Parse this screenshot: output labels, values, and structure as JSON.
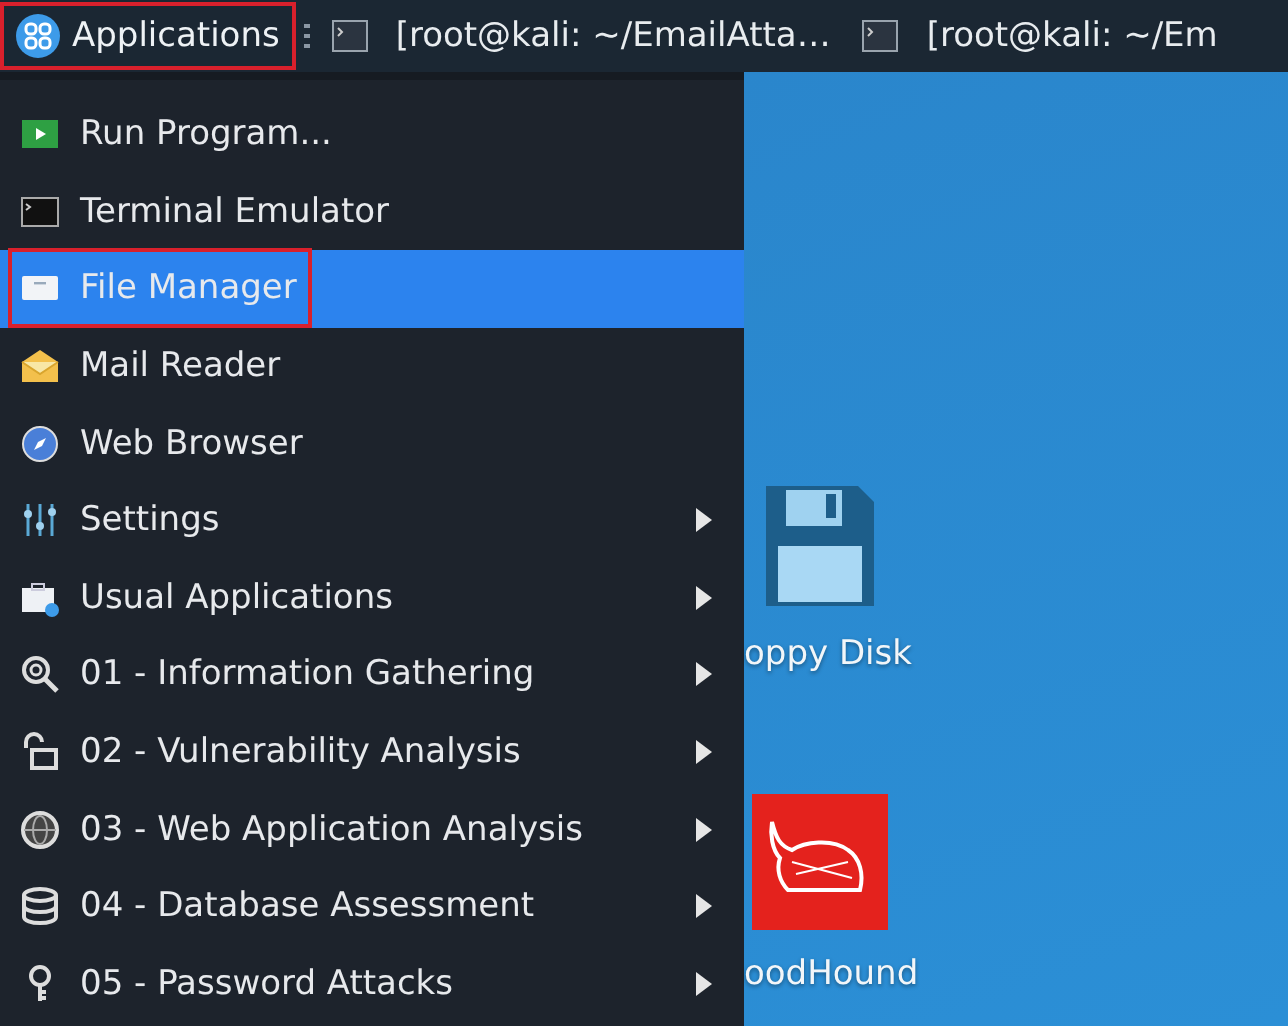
{
  "taskbar": {
    "apps_button": {
      "label": "Applications",
      "highlighted": true
    },
    "tasks": [
      {
        "label": "[root@kali: ~/EmailAtta…"
      },
      {
        "label": "[root@kali: ~/Em"
      }
    ]
  },
  "menu": {
    "items": [
      {
        "label": "Run Program...",
        "submenu": false,
        "selected": false,
        "highlighted": false
      },
      {
        "label": "Terminal Emulator",
        "submenu": false,
        "selected": false,
        "highlighted": false
      },
      {
        "label": "File Manager",
        "submenu": false,
        "selected": true,
        "highlighted": true
      },
      {
        "label": "Mail Reader",
        "submenu": false,
        "selected": false,
        "highlighted": false
      },
      {
        "label": "Web Browser",
        "submenu": false,
        "selected": false,
        "highlighted": false
      },
      {
        "label": "Settings",
        "submenu": true,
        "selected": false,
        "highlighted": false
      },
      {
        "label": "Usual Applications",
        "submenu": true,
        "selected": false,
        "highlighted": false
      },
      {
        "label": "01 - Information Gathering",
        "submenu": true,
        "selected": false,
        "highlighted": false
      },
      {
        "label": "02 - Vulnerability Analysis",
        "submenu": true,
        "selected": false,
        "highlighted": false
      },
      {
        "label": "03 - Web Application Analysis",
        "submenu": true,
        "selected": false,
        "highlighted": false
      },
      {
        "label": "04 - Database Assessment",
        "submenu": true,
        "selected": false,
        "highlighted": false
      },
      {
        "label": "05 - Password Attacks",
        "submenu": true,
        "selected": false,
        "highlighted": false
      }
    ]
  },
  "desktop": {
    "icons": [
      {
        "label": "oppy Disk",
        "kind": "floppy"
      },
      {
        "label": "oodHound",
        "kind": "app"
      }
    ]
  }
}
